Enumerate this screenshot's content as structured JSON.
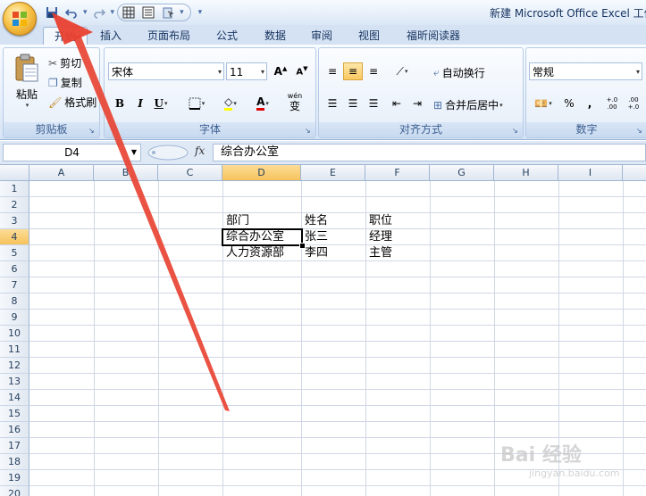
{
  "window": {
    "title": "新建 Microsoft Office Excel 工作表"
  },
  "quick_access": {
    "items": [
      "save-icon",
      "undo-icon",
      "redo-icon",
      "borders-icon",
      "align-icon",
      "touch-icon"
    ]
  },
  "tabs": [
    {
      "label": "开始",
      "active": true
    },
    {
      "label": "插入",
      "active": false
    },
    {
      "label": "页面布局",
      "active": false
    },
    {
      "label": "公式",
      "active": false
    },
    {
      "label": "数据",
      "active": false
    },
    {
      "label": "审阅",
      "active": false
    },
    {
      "label": "视图",
      "active": false
    },
    {
      "label": "福昕阅读器",
      "active": false
    }
  ],
  "ribbon": {
    "clipboard": {
      "label": "剪贴板",
      "paste": "粘贴",
      "cut": "剪切",
      "copy": "复制",
      "format_painter": "格式刷"
    },
    "font": {
      "label": "字体",
      "font_name": "宋体",
      "font_size": "11",
      "bold": "B",
      "italic": "I",
      "underline": "U",
      "wen": "wén",
      "wen_char": "变"
    },
    "alignment": {
      "label": "对齐方式",
      "wrap_text": "自动换行",
      "merge_center": "合并后居中"
    },
    "number": {
      "label": "数字",
      "format": "常规",
      "percent": "%",
      "comma": ",",
      "inc_decimal": "+.0 .00",
      "dec_decimal": ".00 +.0"
    }
  },
  "formula_bar": {
    "name_box": "D4",
    "fx": "fx",
    "content": "综合办公室"
  },
  "sheet": {
    "columns": [
      "A",
      "B",
      "C",
      "D",
      "E",
      "F",
      "G",
      "H",
      "I"
    ],
    "selected_column": "D",
    "rows": [
      "1",
      "2",
      "3",
      "4",
      "5",
      "6",
      "7",
      "8",
      "9",
      "10",
      "11",
      "12",
      "13",
      "14",
      "15",
      "16",
      "17",
      "18",
      "19",
      "20"
    ],
    "selected_row": "4",
    "cells": {
      "D3": "部门",
      "E3": "姓名",
      "F3": "职位",
      "D4": "综合办公室",
      "E4": "张三",
      "F4": "经理",
      "D5": "人力资源部",
      "E5": "李四",
      "F5": "主管"
    },
    "active_cell": "D4"
  },
  "watermark": {
    "text": "Bai 经验",
    "sub": "jingyan.baidu.com"
  },
  "colors": {
    "accent": "#4a7ebb",
    "annotation_arrow": "#e8402f",
    "selected_header": "#f7c25b"
  }
}
